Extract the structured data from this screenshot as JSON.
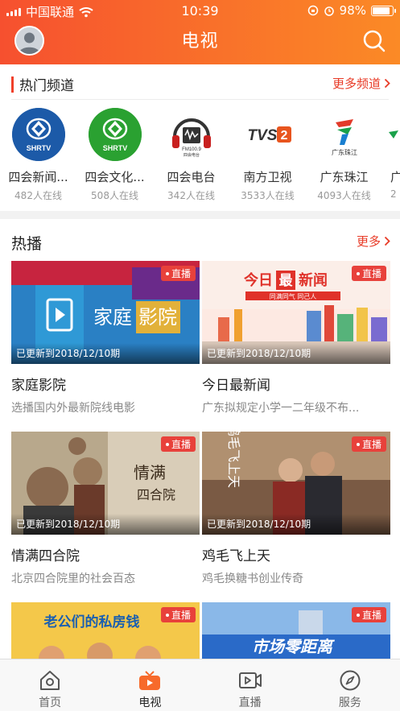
{
  "status_bar": {
    "carrier": "中国联通",
    "time": "10:39",
    "battery": "98%"
  },
  "header": {
    "title": "电视"
  },
  "hot_channels": {
    "title": "热门频道",
    "more": "更多频道",
    "items": [
      {
        "name": "四会新闻...",
        "online": "482人在线",
        "logo_text": "SHRTV",
        "color": "#1c5aa8"
      },
      {
        "name": "四会文化...",
        "online": "508人在线",
        "logo_text": "SHRTV",
        "color": "#2aa131"
      },
      {
        "name": "四会电台",
        "online": "342人在线",
        "logo_text": "FM100.9",
        "logo_sub": "四会电台",
        "color": "#c8201f"
      },
      {
        "name": "南方卫视",
        "online": "3533人在线",
        "logo_text": "TVS2",
        "color": "#e8551e"
      },
      {
        "name": "广东珠江",
        "online": "4093人在线",
        "logo_text": "广东珠江",
        "color": "#1aa14a"
      },
      {
        "name": "广",
        "online": "2",
        "color": "#1aa14a"
      }
    ]
  },
  "hot": {
    "title": "热播",
    "more": "更多",
    "live_label": "直播",
    "cards": [
      {
        "title": "家庭影院",
        "subtitle": "选播国内外最新院线电影",
        "update": "已更新到2018/12/10期",
        "poster_text_1": "家庭",
        "poster_text_2": "影院"
      },
      {
        "title": "今日最新闻",
        "subtitle": "广东拟规定小学一二年级不布...",
        "update": "已更新到2018/12/10期",
        "poster_text_1": "今日",
        "poster_text_2": "最",
        "poster_text_3": "新闻",
        "poster_sub": "同满同气 同己人"
      },
      {
        "title": "情满四合院",
        "subtitle": "北京四合院里的社会百态",
        "update": "已更新到2018/12/10期",
        "poster_text_1": "情满",
        "poster_text_2": "四合院"
      },
      {
        "title": "鸡毛飞上天",
        "subtitle": "鸡毛换糖书创业传奇",
        "update": "已更新到2018/12/10期",
        "poster_text_1": "鸡毛飞上天"
      },
      {
        "title": "",
        "subtitle": "",
        "update": "",
        "poster_text_1": "老公们的私房钱"
      },
      {
        "title": "",
        "subtitle": "",
        "update": "",
        "poster_text_1": "市场零距离"
      }
    ]
  },
  "tabbar": {
    "items": [
      {
        "label": "首页",
        "icon": "home-icon"
      },
      {
        "label": "电视",
        "icon": "tv-icon"
      },
      {
        "label": "直播",
        "icon": "live-video-icon"
      },
      {
        "label": "服务",
        "icon": "compass-icon"
      }
    ],
    "accent": "#f76a2b"
  }
}
